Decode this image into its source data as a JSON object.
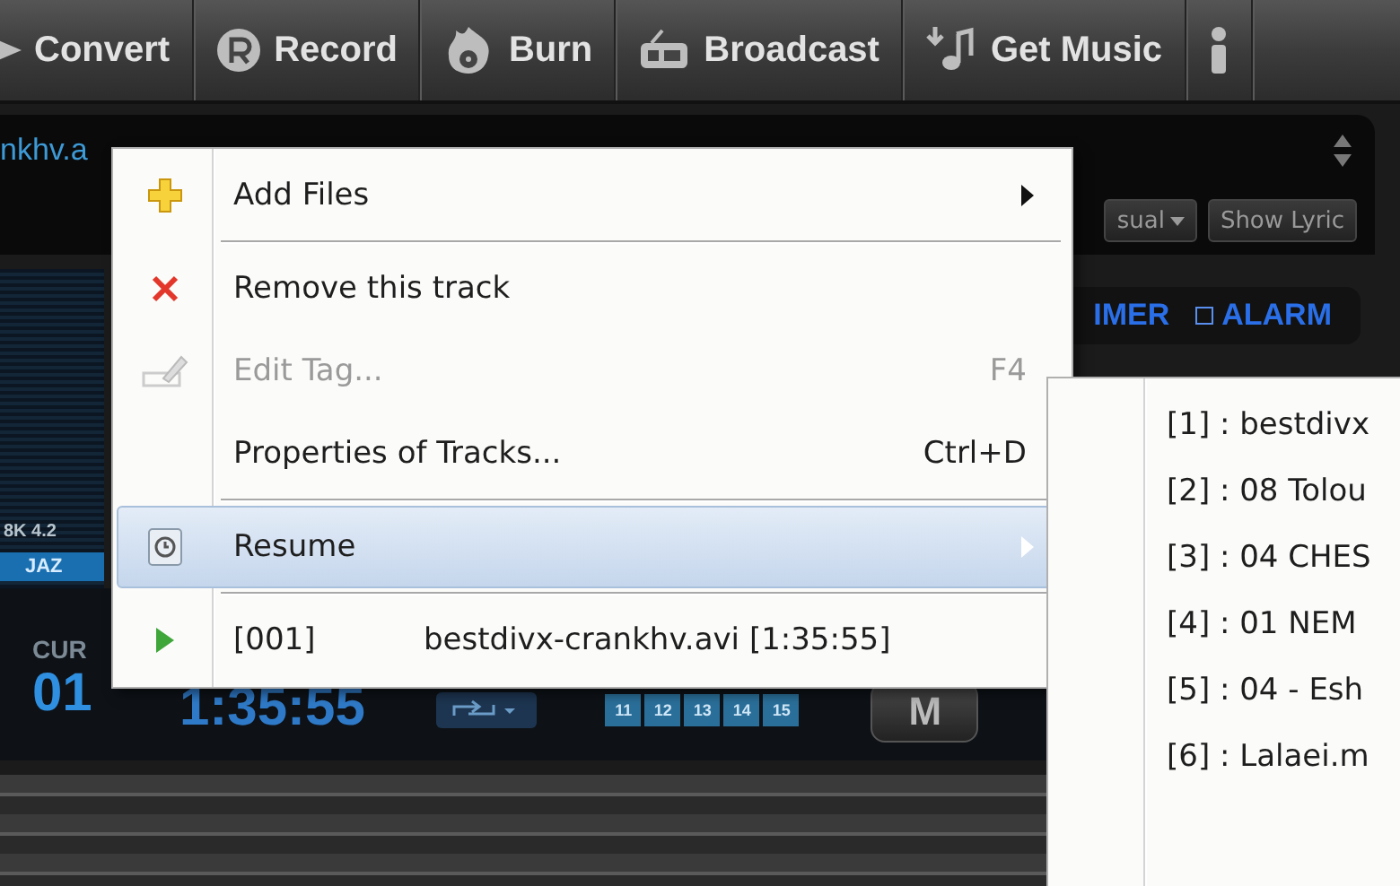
{
  "toolbar": {
    "items": [
      {
        "kind": "convert",
        "label": "Convert"
      },
      {
        "kind": "record",
        "label": "Record"
      },
      {
        "kind": "burn",
        "label": "Burn"
      },
      {
        "kind": "broadcast",
        "label": "Broadcast"
      },
      {
        "kind": "music",
        "label": "Get Music"
      },
      {
        "kind": "info"
      }
    ]
  },
  "player": {
    "title": "nkhv.a",
    "view_buttons": [
      {
        "label": "sual",
        "dropdown": true
      },
      {
        "label": "Show Lyric",
        "dropdown": false
      }
    ],
    "timer": {
      "label": "IMER"
    },
    "alarm": {
      "label": "ALARM",
      "checked": false
    },
    "eq_freqs": "8K  4.2",
    "eq_preset": "JAZ",
    "counter_label": "CUR",
    "counter": "01",
    "time": "1:35:55",
    "chips": [
      "11",
      "12",
      "13",
      "14",
      "15"
    ],
    "mode_button": "M"
  },
  "context_menu": {
    "items": [
      {
        "kind": "add",
        "label": "Add Files",
        "submenu": true,
        "disabled": false,
        "selected": false
      },
      {
        "kind": "separator"
      },
      {
        "kind": "remove",
        "label": "Remove this track",
        "submenu": false,
        "disabled": false,
        "selected": false
      },
      {
        "kind": "edit",
        "label": "Edit Tag...",
        "shortcut": "F4",
        "submenu": false,
        "disabled": true,
        "selected": false
      },
      {
        "kind": "plain",
        "label": "Properties of Tracks...",
        "shortcut": "Ctrl+D",
        "submenu": false,
        "disabled": false,
        "selected": false
      },
      {
        "kind": "separator"
      },
      {
        "kind": "resume",
        "label": "Resume",
        "submenu": true,
        "disabled": false,
        "selected": true
      },
      {
        "kind": "separator"
      },
      {
        "kind": "track",
        "number": "[001]",
        "label": "bestdivx-crankhv.avi [1:35:55]",
        "disabled": false,
        "selected": false
      }
    ]
  },
  "submenu": {
    "items": [
      {
        "label": "[1] : bestdivx"
      },
      {
        "label": "[2] : 08 Tolou"
      },
      {
        "label": "[3] : 04 CHES"
      },
      {
        "label": "[4] : 01 NEM"
      },
      {
        "label": "[5] : 04 - Esh"
      },
      {
        "label": "[6] : Lalaei.m"
      }
    ]
  }
}
